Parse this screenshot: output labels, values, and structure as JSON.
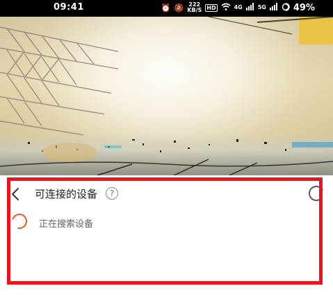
{
  "status_bar": {
    "time": "09:41",
    "network_speed_top": "222",
    "network_speed_bottom": "KB/S",
    "hd_label": "HD",
    "signal1_label": "4G",
    "signal2_label": "5G",
    "battery_text": "49%"
  },
  "panel": {
    "title": "可连接的设备",
    "help_symbol": "?",
    "searching_text": "正在搜索设备"
  },
  "colors": {
    "spinner": "#e8562a",
    "highlight": "#e8141e"
  }
}
